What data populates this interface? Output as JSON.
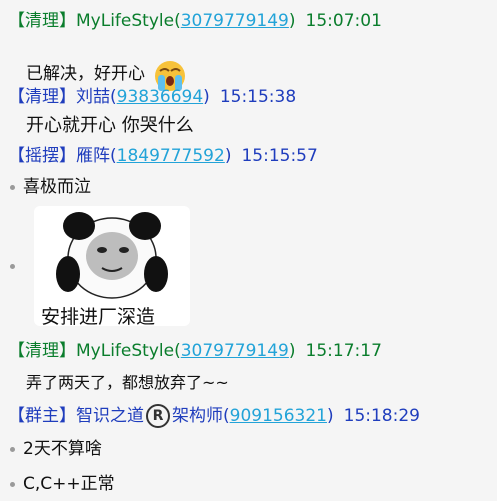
{
  "messages": [
    {
      "role": "【清理】",
      "name": "MyLifeStyle",
      "qq": "3079779149",
      "time": "15:07:01",
      "text": "已解决，好开心"
    },
    {
      "role": "【清理】",
      "name": "刘喆",
      "qq": "93836694",
      "time": "15:15:38",
      "text": "开心就开心  你哭什么"
    },
    {
      "role": "【摇摆】",
      "name": "雁阵",
      "qq": "1849777592",
      "time": "15:15:57",
      "text": "喜极而泣",
      "sticker_caption": "安排进厂深造"
    },
    {
      "role": "【清理】",
      "name": "MyLifeStyle",
      "qq": "3079779149",
      "time": "15:17:17",
      "text": "弄了两天了，都想放弃了~~"
    },
    {
      "role": "【群主】",
      "name_pre": "智识之道",
      "name_post": "架构师",
      "qq": "909156321",
      "time": "15:18:29",
      "texts": [
        "2天不算啥",
        "C,C++正常"
      ]
    }
  ],
  "icons": {
    "crying_emoji": "crying-face",
    "registered": "registered-mark",
    "bullet": "bullet-dot"
  },
  "colors": {
    "green": "#0a7d2c",
    "blue": "#1f3dbd",
    "link": "#22a3d8"
  }
}
